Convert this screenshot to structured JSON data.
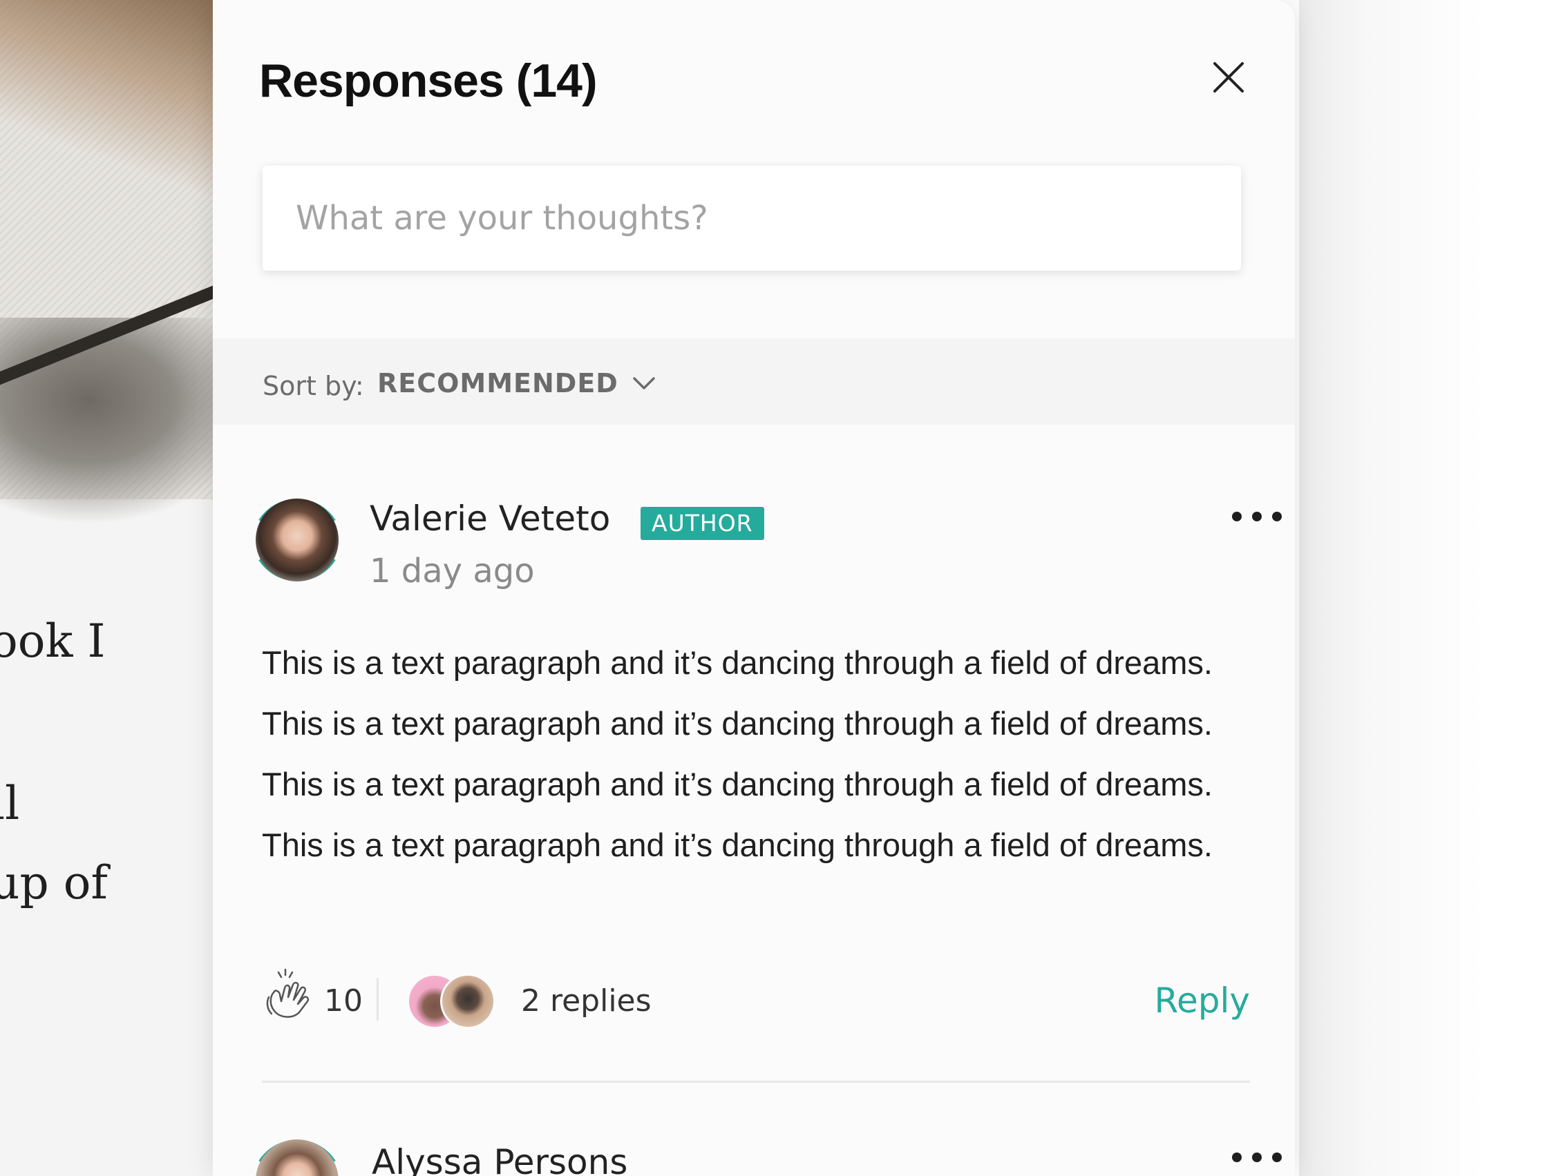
{
  "background_article": {
    "lines": [
      "ook I",
      "ll",
      "up of"
    ]
  },
  "panel": {
    "title": "Responses (14)",
    "composer_placeholder": "What are your thoughts?"
  },
  "sort": {
    "label": "Sort by:",
    "value": "RECOMMENDED"
  },
  "comments": [
    {
      "author": "Valerie Veteto",
      "badge": "AUTHOR",
      "time": "1 day ago",
      "body": "This is a text paragraph and it’s dancing through a field of dreams. This is a text paragraph and it’s dancing through a field of dreams. This is a text paragraph and it’s dancing through a field of dreams. This is a text paragraph and it’s dancing through a field of dreams.",
      "claps": "10",
      "replies": "2 replies",
      "reply_label": "Reply"
    },
    {
      "author": "Alyssa Persons"
    }
  ],
  "icons": {
    "close": "close-icon",
    "chevron": "chevron-down-icon",
    "more": "more-icon",
    "clap": "clap-icon"
  },
  "colors": {
    "accent": "#25ab9c",
    "text": "#1f1f1f",
    "muted": "#8a8a8a"
  }
}
